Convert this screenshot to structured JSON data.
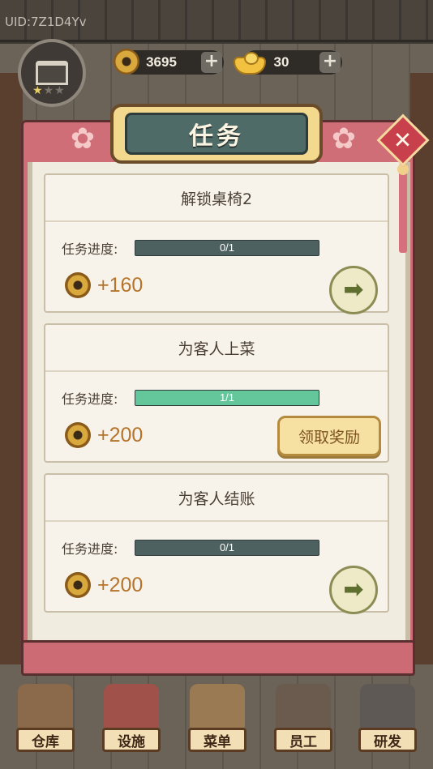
{
  "header": {
    "uid": "UID:7Z1D4Yv",
    "coins": "3695",
    "ingots": "30",
    "plus_label": "+",
    "shop_stars": 1,
    "shop_stars_max": 3
  },
  "panel": {
    "title": "任务",
    "close_label": "✕"
  },
  "tasks": [
    {
      "title": "解锁桌椅2",
      "progress_label": "任务进度:",
      "progress_text": "0/1",
      "progress_fraction": 0,
      "reward": "+160",
      "action": "go"
    },
    {
      "title": "为客人上菜",
      "progress_label": "任务进度:",
      "progress_text": "1/1",
      "progress_fraction": 1,
      "reward": "+200",
      "action": "claim",
      "claim_label": "领取奖励"
    },
    {
      "title": "为客人结账",
      "progress_label": "任务进度:",
      "progress_text": "0/1",
      "progress_fraction": 0,
      "reward": "+200",
      "action": "go"
    }
  ],
  "nav": {
    "items": [
      {
        "label": "仓库",
        "icon": "warehouse-icon",
        "color": "#8a6a4a"
      },
      {
        "label": "设施",
        "icon": "facility-icon",
        "color": "#a0524a"
      },
      {
        "label": "菜单",
        "icon": "menu-book-icon",
        "color": "#9a7a52"
      },
      {
        "label": "员工",
        "icon": "staff-icon",
        "color": "#6b5a4e"
      },
      {
        "label": "研发",
        "icon": "research-pot-icon",
        "color": "#5e5954"
      }
    ]
  },
  "colors": {
    "progress_fill": "#64c79c",
    "progress_track": "#4d6260",
    "reward_text": "#b5742b",
    "panel_frame": "#d06e77"
  }
}
